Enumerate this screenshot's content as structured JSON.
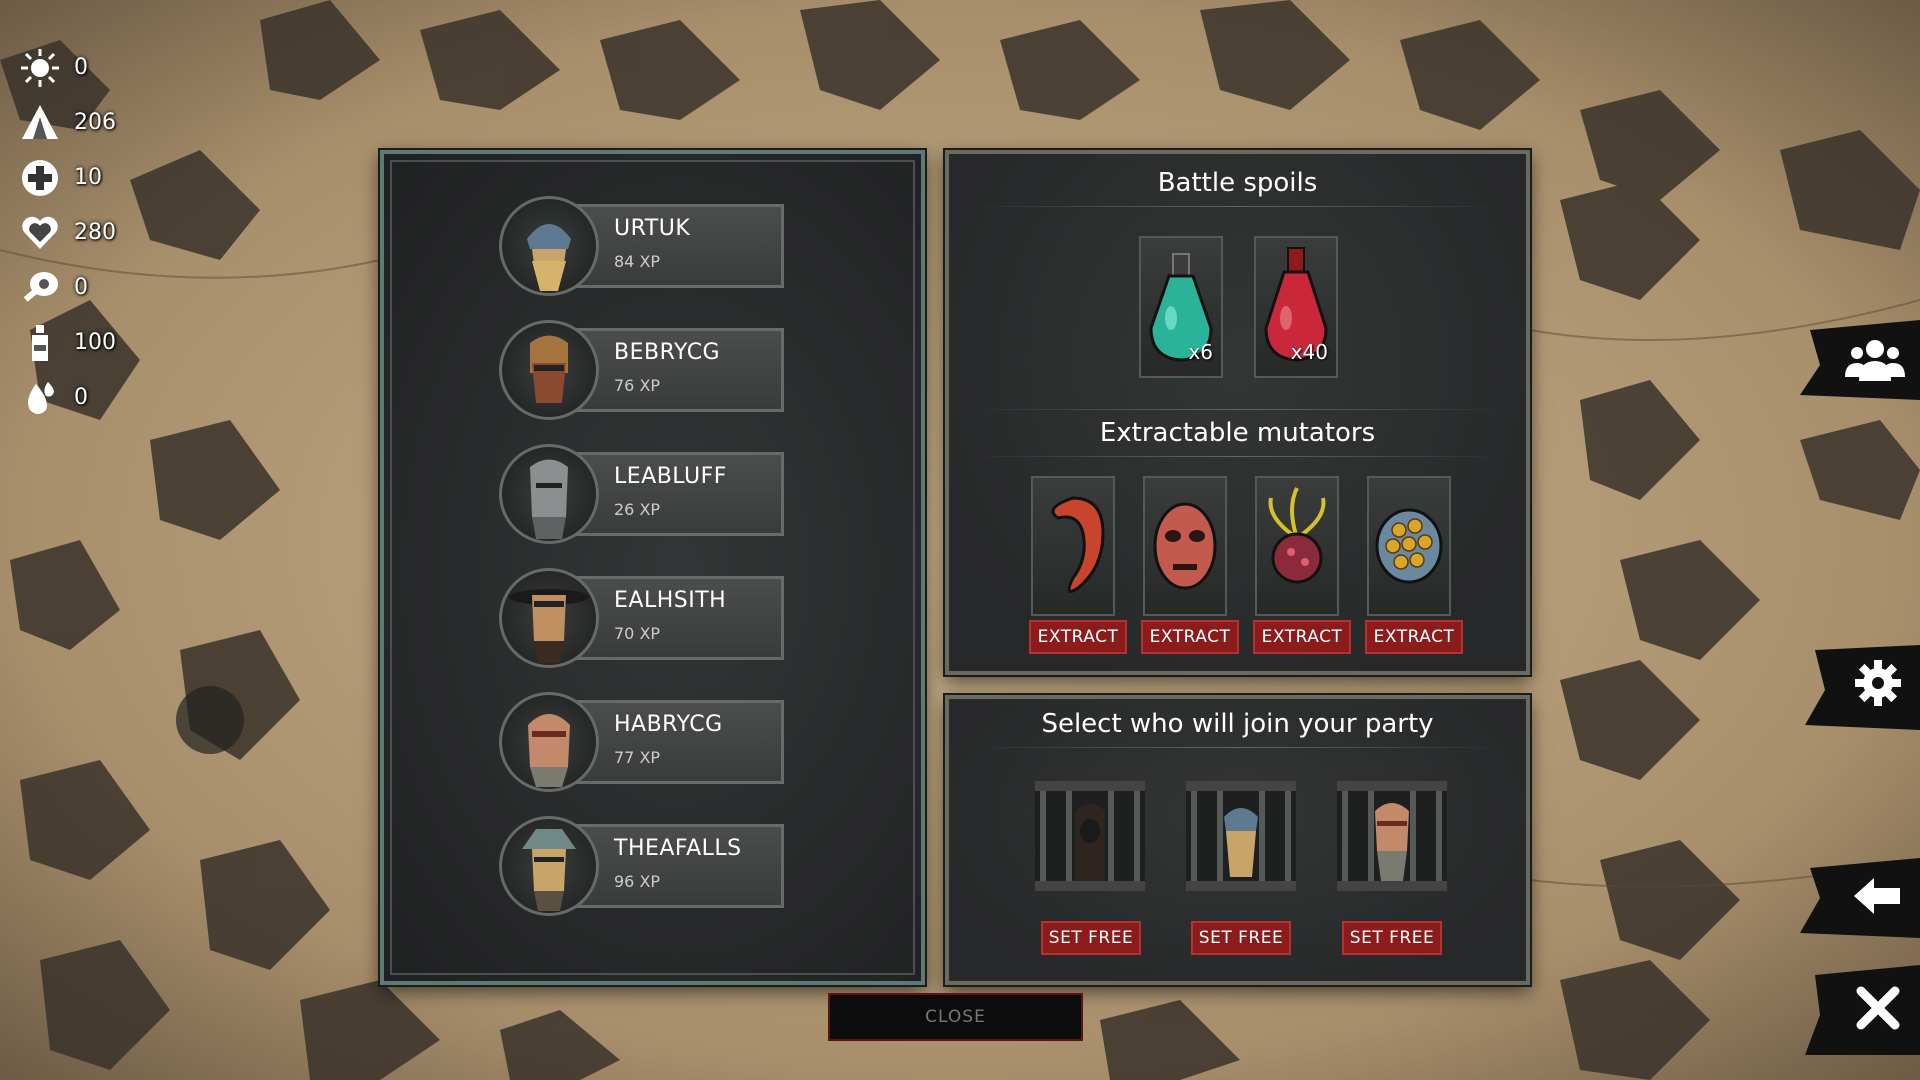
{
  "resources": [
    {
      "icon": "sun-icon",
      "value": "0"
    },
    {
      "icon": "tent-icon",
      "value": "206"
    },
    {
      "icon": "medical-cross-icon",
      "value": "10"
    },
    {
      "icon": "heart-icon",
      "value": "280"
    },
    {
      "icon": "meat-icon",
      "value": "0"
    },
    {
      "icon": "bottle-icon",
      "value": "100"
    },
    {
      "icon": "droplets-icon",
      "value": "0"
    }
  ],
  "heroes": [
    {
      "name": "URTUK",
      "xp": "84 XP"
    },
    {
      "name": "BEBRYCG",
      "xp": "76 XP"
    },
    {
      "name": "LEABLUFF",
      "xp": "26 XP"
    },
    {
      "name": "EALHSITH",
      "xp": "70 XP"
    },
    {
      "name": "HABRYCG",
      "xp": "77 XP"
    },
    {
      "name": "THEAFALLS",
      "xp": "96 XP"
    }
  ],
  "spoils": {
    "title": "Battle spoils",
    "items": [
      {
        "icon": "teal-potion-icon",
        "count": "x6",
        "color": "#2bb39a"
      },
      {
        "icon": "red-potion-icon",
        "count": "x40",
        "color": "#c8283a"
      }
    ]
  },
  "mutators": {
    "title": "Extractable mutators",
    "extract_label": "EXTRACT",
    "items": [
      {
        "icon": "red-tentacle-icon"
      },
      {
        "icon": "fleshy-mask-icon"
      },
      {
        "icon": "tendril-heart-icon"
      },
      {
        "icon": "egg-pod-icon"
      }
    ]
  },
  "party": {
    "title": "Select who will join your party",
    "set_free_label": "SET FREE",
    "prisoners": [
      {
        "icon": "caged-prisoner-icon"
      },
      {
        "icon": "caged-prisoner-icon"
      },
      {
        "icon": "caged-prisoner-icon"
      }
    ]
  },
  "close_label": "CLOSE",
  "side_buttons": [
    "party-icon",
    "gear-icon",
    "back-arrow-icon",
    "close-icon"
  ]
}
